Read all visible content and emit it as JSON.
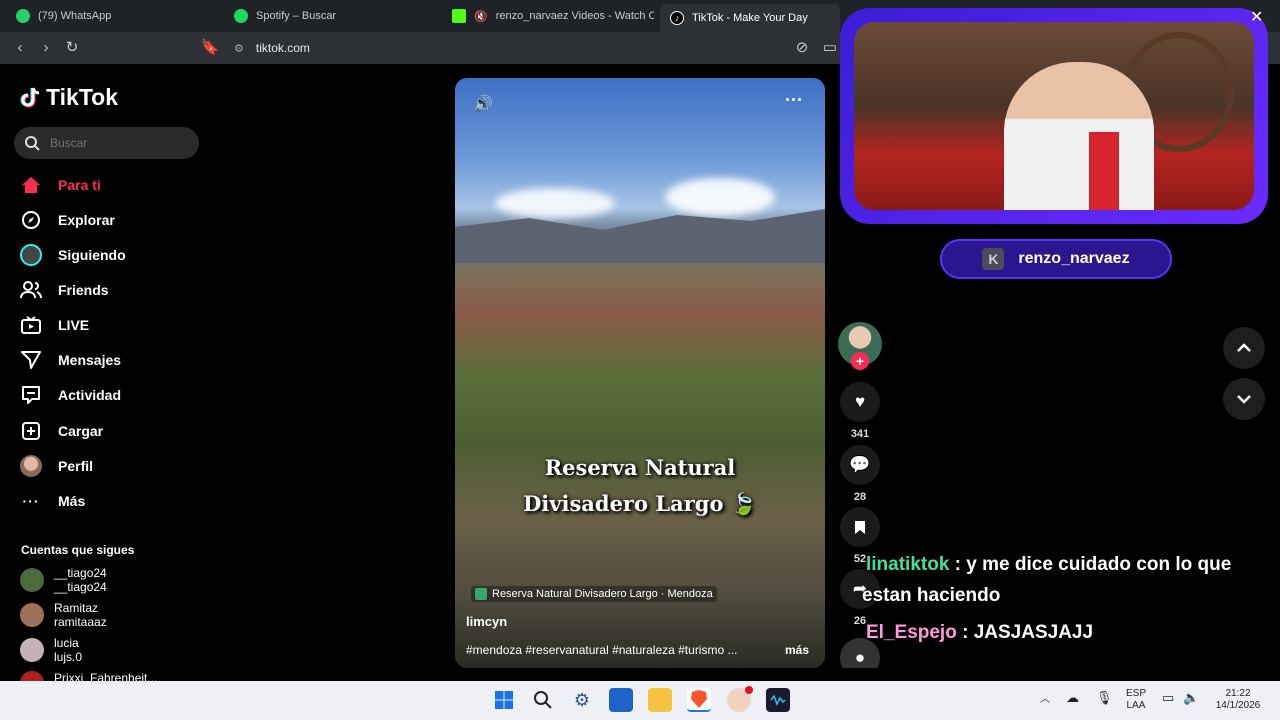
{
  "browser": {
    "tabs": [
      {
        "label": "(79) WhatsApp",
        "color": "#25d366"
      },
      {
        "label": "Spotify – Buscar",
        "color": "#1ed760"
      },
      {
        "label": "renzo_narvaez Videos - Watch On",
        "color": "#53fc18"
      },
      {
        "label": "TikTok - Make Your Day",
        "color": "#ffffff"
      }
    ],
    "url": "tiktok.com"
  },
  "sidebar": {
    "brand": "TikTok",
    "search_placeholder": "Buscar",
    "items": [
      {
        "label": "Para ti",
        "icon": "home-icon",
        "active": true
      },
      {
        "label": "Explorar",
        "icon": "compass-icon"
      },
      {
        "label": "Siguiendo",
        "icon": "following-avatar-icon"
      },
      {
        "label": "Friends",
        "icon": "friends-icon"
      },
      {
        "label": "LIVE",
        "icon": "live-icon"
      },
      {
        "label": "Mensajes",
        "icon": "send-icon"
      },
      {
        "label": "Actividad",
        "icon": "activity-icon"
      },
      {
        "label": "Cargar",
        "icon": "upload-icon"
      },
      {
        "label": "Perfil",
        "icon": "profile-avatar-icon"
      },
      {
        "label": "Más",
        "icon": "more-icon"
      }
    ],
    "following_title": "Cuentas que sigues",
    "following": [
      {
        "name": "__tiago24",
        "handle": "__tiago24"
      },
      {
        "name": "Ramitaz",
        "handle": "ramitaaaz"
      },
      {
        "name": "lucia",
        "handle": "lujs.0"
      },
      {
        "name": "Prixxi_Fahrenheit...",
        "handle": ""
      }
    ]
  },
  "video": {
    "title_line1": "Reserva Natural",
    "title_line2": "Divisadero Largo 🍃",
    "location": "Reserva Natural Divisadero Largo · Mendoza",
    "author": "limcyn",
    "caption": "#mendoza #reservanatural #naturaleza #turismo ...",
    "more": "más"
  },
  "actions": {
    "likes": "341",
    "comments": "28",
    "saves": "52",
    "shares": "26"
  },
  "stream": {
    "channel": "renzo_narvaez",
    "chat": [
      {
        "user": "linatiktok",
        "user_color": "#3fe0a0",
        "message": " : y me dice cuidado con lo que",
        "message2": "estan haciendo"
      },
      {
        "user": "El_Espejo",
        "user_color": "#ff99dd",
        "message": " : JASJASJAJJ"
      }
    ]
  },
  "taskbar": {
    "lang1": "ESP",
    "lang2": "LAA",
    "time": "21:22",
    "date": "14/1/2026"
  }
}
